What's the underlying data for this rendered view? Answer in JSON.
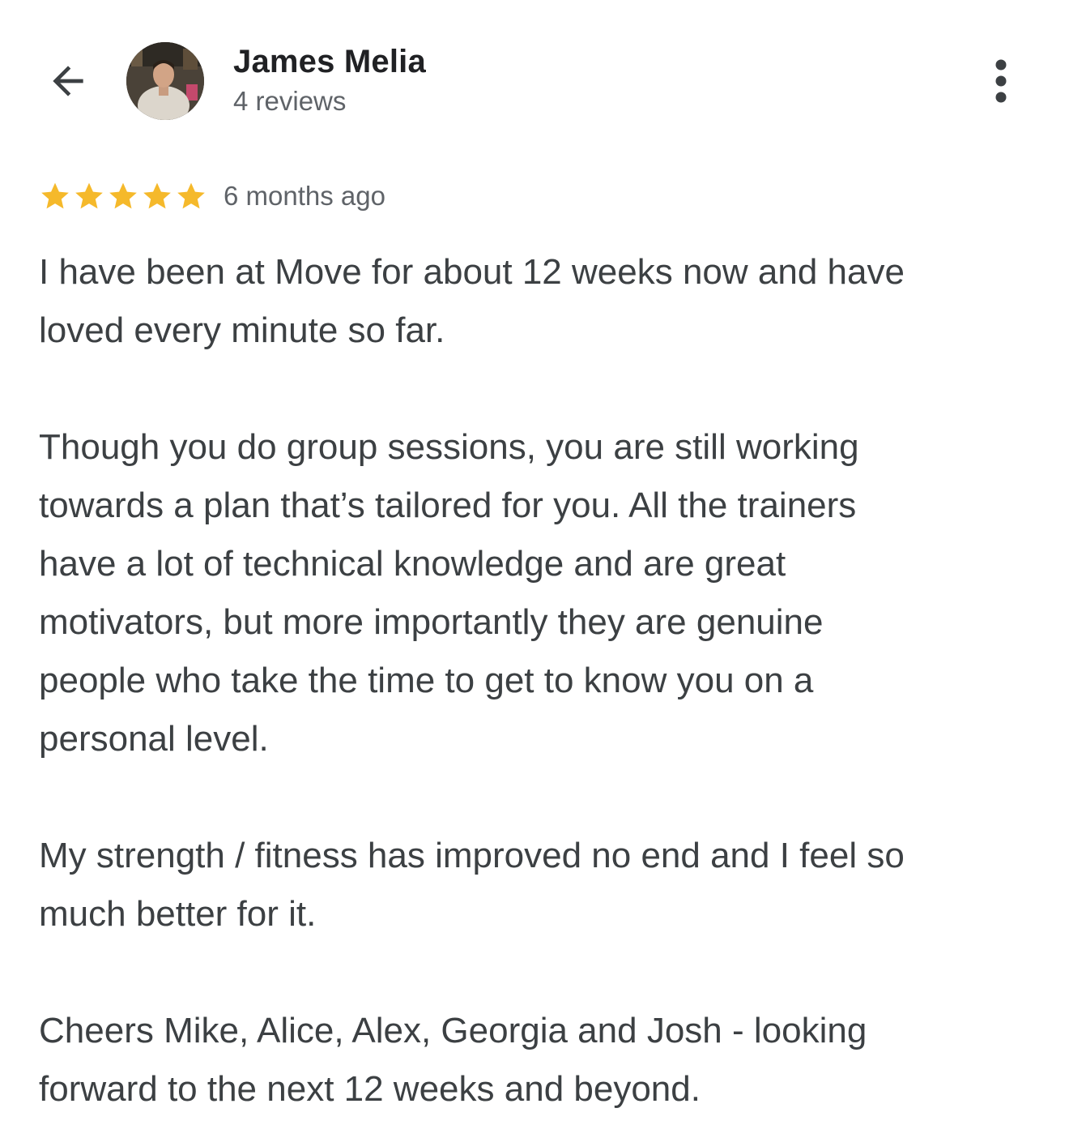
{
  "reviewer": {
    "name": "James Melia",
    "review_count": "4 reviews",
    "avatar_icon": "person-photo-avatar"
  },
  "header": {
    "back_icon": "arrow-left-icon",
    "more_icon": "more-vertical-icon"
  },
  "review": {
    "rating": 5,
    "rating_max": 5,
    "star_color": "#f5b92b",
    "time_ago": "6 months ago",
    "paragraphs": [
      "I have been at Move for about 12 weeks now and have\nloved every minute so far.",
      "Though you do group sessions, you are still working\ntowards a plan that’s tailored for you. All the trainers\nhave a lot of technical knowledge and are great\nmotivators, but more importantly they are genuine\npeople who take the time to get to know you on a\npersonal level.",
      "My strength / fitness has improved no end and I feel so\nmuch better for it.",
      "Cheers Mike, Alice, Alex, Georgia and Josh - looking\nforward to the next 12 weeks and beyond."
    ]
  }
}
